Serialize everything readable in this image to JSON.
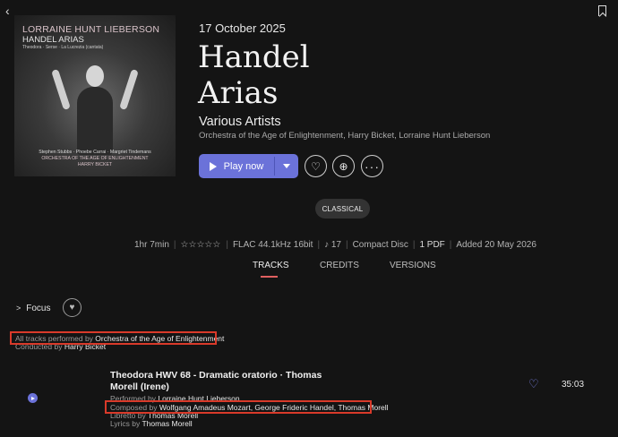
{
  "album": {
    "date": "17 October 2025",
    "title_line1": "Handel",
    "title_line2": "Arias",
    "artist": "Various Artists",
    "performers": "Orchestra of the Age of Enlightenment, Harry Bicket, Lorraine Hunt Lieberson",
    "genre": "CLASSICAL"
  },
  "cover": {
    "artist": "LORRAINE HUNT LIEBERSON",
    "title": "HANDEL ARIAS",
    "subtitle": "Theodora · Serse · La Lucrezia (cantata)",
    "credits_line1": "Stephen Stubbs · Phoebe Carrai · Margriet Tindemans",
    "credits_line2": "ORCHESTRA OF THE AGE OF ENLIGHTENMENT",
    "credits_line3": "HARRY BICKET"
  },
  "actions": {
    "play_label": "Play now"
  },
  "meta": {
    "duration": "1hr 7min",
    "stars": "☆☆☆☆☆",
    "quality": "FLAC 44.1kHz 16bit",
    "tracks": "17",
    "format": "Compact Disc",
    "pdf": "1 PDF",
    "added": "Added 20 May 2026"
  },
  "tabs": {
    "tracks": "TRACKS",
    "credits": "CREDITS",
    "versions": "VERSIONS"
  },
  "focus": {
    "label": "Focus"
  },
  "notes": {
    "performed_prefix": "All tracks performed by ",
    "performed_by": "Orchestra of the Age of Enlightenment",
    "conducted_prefix": "Conducted by ",
    "conducted_by": "Harry Bicket"
  },
  "track": {
    "title": "Theodora HWV 68 - Dramatic oratorio · Thomas Morell (Irene)",
    "performed_prefix": "Performed by ",
    "performed_by": "Lorraine Hunt Lieberson",
    "composed_prefix": "Composed by ",
    "composed_by": "Wolfgang Amadeus Mozart, George Frideric Handel, Thomas Morell",
    "libretto_prefix": "Libretto by ",
    "libretto_by": "Thomas Morell",
    "lyrics_prefix": "Lyrics by ",
    "lyrics_by": "Thomas Morell",
    "duration": "35:03"
  },
  "colors": {
    "accent": "#6b72d9",
    "highlight_box": "#d93a2a",
    "tab_underline": "#e06060"
  }
}
